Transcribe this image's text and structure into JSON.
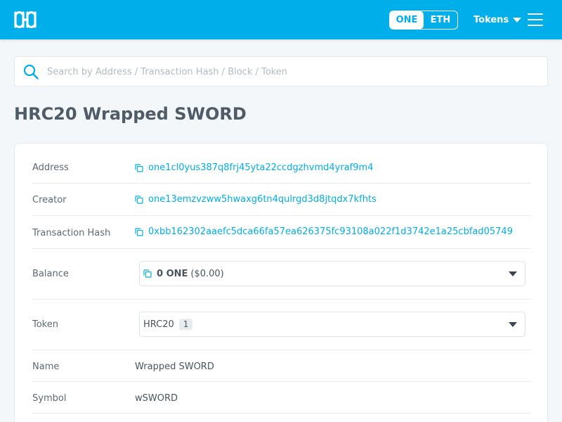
{
  "header": {
    "network_options": [
      "ONE",
      "ETH"
    ],
    "selected_network": "ONE",
    "tokens_menu_label": "Tokens",
    "brand_color": "#00aee9"
  },
  "search": {
    "placeholder": "Search by Address / Transaction Hash / Block / Token"
  },
  "page": {
    "title": "HRC20 Wrapped SWORD"
  },
  "details": {
    "address": {
      "label": "Address",
      "value": "one1cl0yus387q8frj45yta22ccdgzhvmd4yraf9m4"
    },
    "creator": {
      "label": "Creator",
      "value": "one13emzvzww5hwaxg6tn4qulrgd3d8jtqdx7kfhts"
    },
    "tx_hash": {
      "label": "Transaction Hash",
      "value": "0xbb162302aaefc5dca66fa57ea626375fc93108a022f1d3742e1a25cbfad05749"
    },
    "balance": {
      "label": "Balance",
      "amount": "0 ONE",
      "usd": "($0.00)"
    },
    "token": {
      "label": "Token",
      "selected": "HRC20",
      "count": "1"
    },
    "name": {
      "label": "Name",
      "value": "Wrapped SWORD"
    },
    "symbol": {
      "label": "Symbol",
      "value": "wSWORD"
    }
  },
  "icons": [
    "harmony-logo-icon",
    "chevron-down-icon",
    "hamburger-menu-icon",
    "search-icon",
    "copy-icon"
  ]
}
